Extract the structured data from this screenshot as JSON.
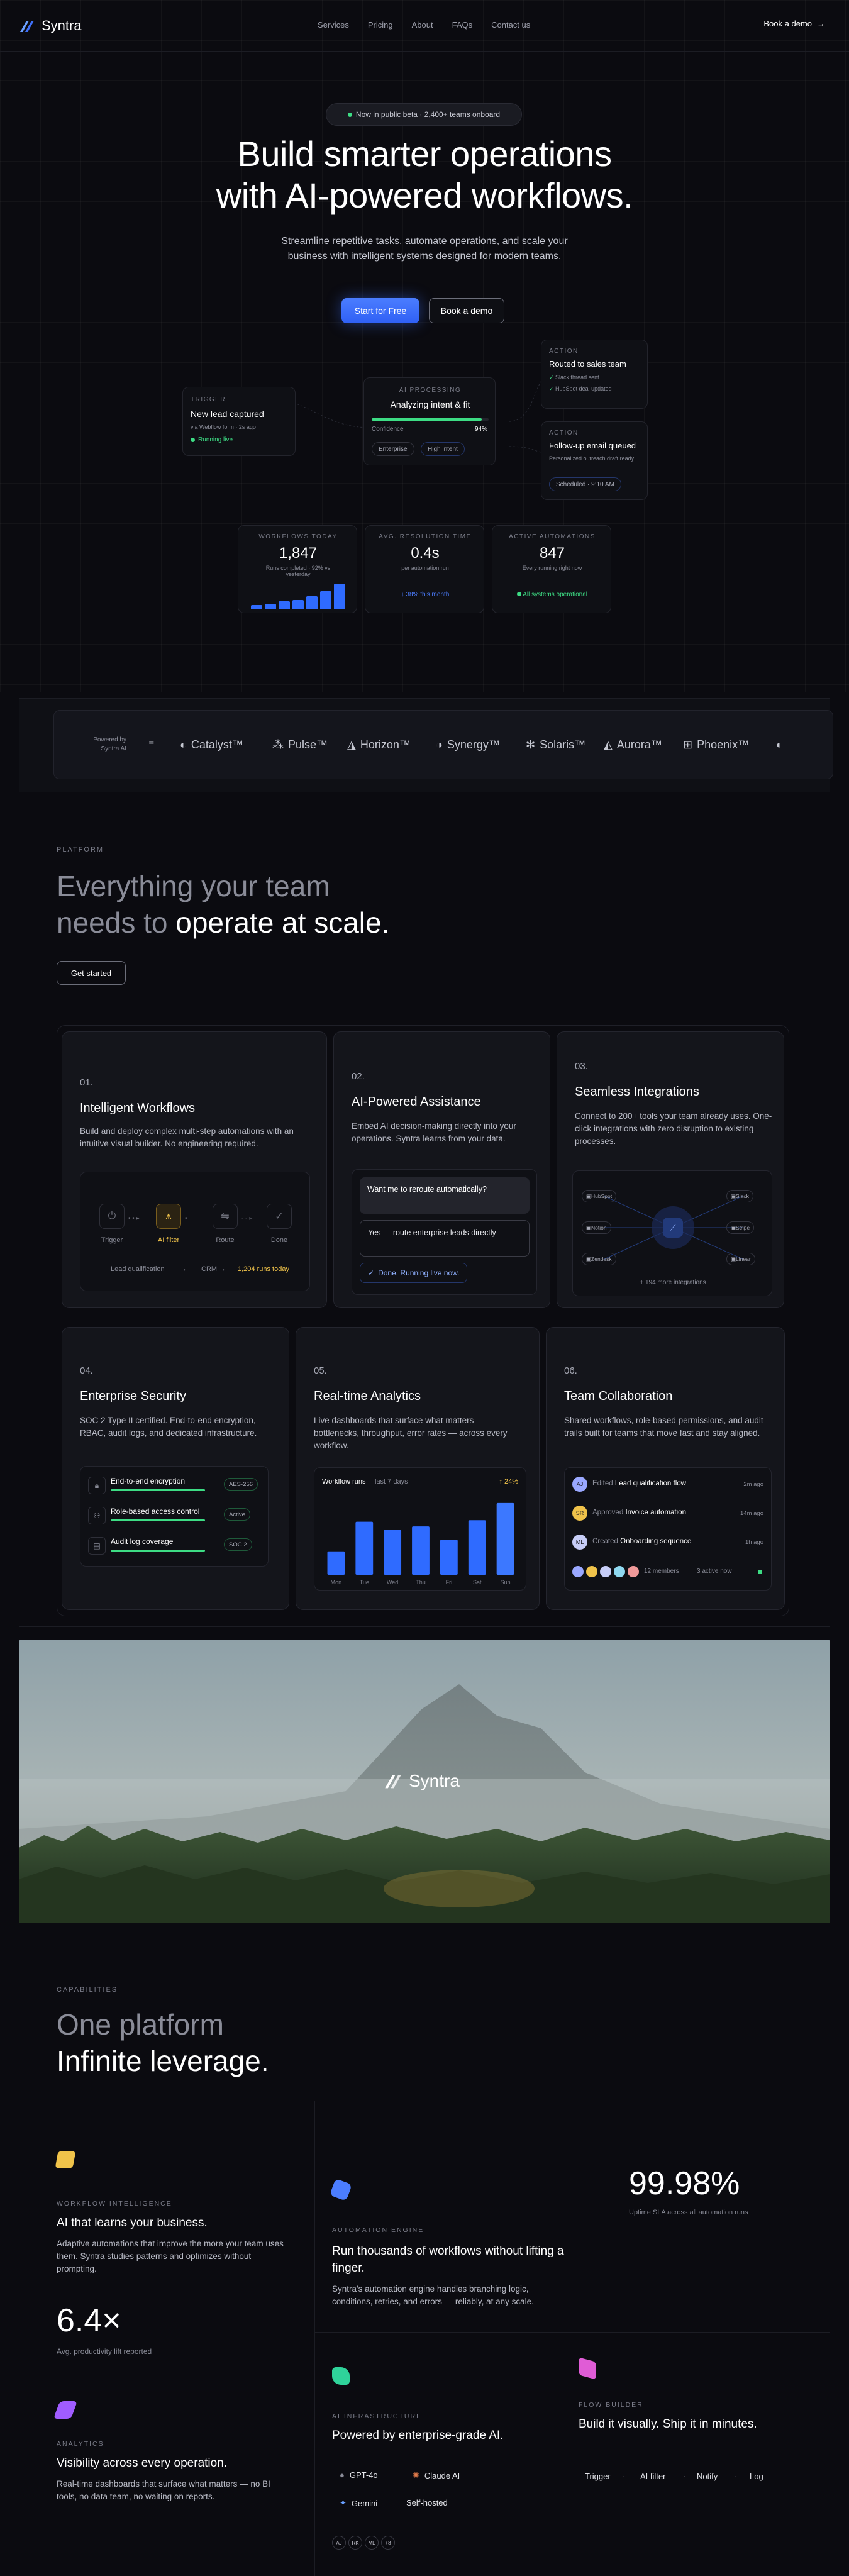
{
  "nav": {
    "brand": "Syntra",
    "links": [
      "Services",
      "Pricing",
      "About",
      "FAQs",
      "Contact us"
    ],
    "cta": "Book a demo"
  },
  "hero": {
    "badge_text": "Now in public beta · 2,400+ teams onboard",
    "title_line1": "Build smarter operations",
    "title_line2": "with AI-powered workflows.",
    "subtitle": "Streamline repetitive tasks, automate operations, and scale your business with intelligent systems designed for modern teams.",
    "cta_primary": "Start for Free",
    "cta_secondary": "Book a demo"
  },
  "flow": {
    "trigger": {
      "tag": "TRIGGER",
      "title": "New lead captured",
      "meta": "via Webflow form · 2s ago",
      "status": "Running live"
    },
    "ai": {
      "tag": "AI PROCESSING",
      "title": "Analyzing intent & fit",
      "label": "Confidence",
      "pct": "94%",
      "progress": 0.94,
      "chip1": "Enterprise",
      "chip2": "High intent"
    },
    "action1": {
      "tag": "ACTION",
      "title": "Routed to sales team",
      "check1": "Slack thread sent",
      "check2": "HubSpot deal updated"
    },
    "action2": {
      "tag": "ACTION",
      "title": "Follow-up email queued",
      "meta": "Personalized outreach draft ready",
      "chip": "Scheduled · 9:10 AM"
    }
  },
  "stats": [
    {
      "tag": "WORKFLOWS TODAY",
      "value": "1,847",
      "meta": "Runs completed · 92% vs yesterday",
      "bars": [
        0.15,
        0.2,
        0.3,
        0.35,
        0.5,
        0.7,
        1.0
      ]
    },
    {
      "tag": "AVG. RESOLUTION TIME",
      "value": "0.4s",
      "meta": "per automation run",
      "foot": "↓ 38% this month"
    },
    {
      "tag": "ACTIVE AUTOMATIONS",
      "value": "847",
      "meta": "Every running right now",
      "foot": "All systems operational"
    }
  ],
  "logos": {
    "powered": "Powered by Syntra AI",
    "items": [
      "Catalyst™",
      "Pulse™",
      "Horizon™",
      "Synergy™",
      "Solaris™",
      "Aurora™",
      "Phoenix™"
    ]
  },
  "platform": {
    "tag": "PLATFORM",
    "title_line1": "Everything your team",
    "title_line2a": "needs to",
    "title_line2b": " operate at scale.",
    "cta": "Get started"
  },
  "features": [
    {
      "num": "01.",
      "title": "Intelligent Workflows",
      "desc": "Build and deploy complex multi-step automations with an intuitive visual builder. No engineering required.",
      "steps": [
        "Trigger",
        "AI filter",
        "Route",
        "Done"
      ],
      "foot_a": "Lead qualification",
      "foot_b": "CRM",
      "foot_c": "1,204 runs today"
    },
    {
      "num": "02.",
      "title": "AI-Powered Assistance",
      "desc": "Embed AI decision-making directly into your operations. Syntra learns from your data.",
      "msg1": "Want me to reroute automatically?",
      "msg2": "Yes — route enterprise leads directly",
      "msg3": "Done. Running live now."
    },
    {
      "num": "03.",
      "title": "Seamless Integrations",
      "desc": "Connect to 200+ tools your team already uses. One-click integrations with zero disruption to existing processes.",
      "apps": [
        "HubSpot",
        "Slack",
        "Notion",
        "Stripe",
        "Zendesk",
        "Linear"
      ],
      "foot": "+ 194 more integrations"
    },
    {
      "num": "04.",
      "title": "Enterprise Security",
      "desc": "SOC 2 Type II certified. End-to-end encryption, RBAC, audit logs, and dedicated infrastructure.",
      "rows": [
        {
          "label": "End-to-end encryption",
          "badge": "AES-256"
        },
        {
          "label": "Role-based access control",
          "badge": "Active"
        },
        {
          "label": "Audit log coverage",
          "badge": "SOC 2"
        }
      ]
    },
    {
      "num": "05.",
      "title": "Real-time Analytics",
      "desc": "Live dashboards that surface what matters — bottlenecks, throughput, error rates — across every workflow.",
      "chart_title": "Workflow runs",
      "chart_range": "last 7 days",
      "chart_delta": "↑ 24%"
    },
    {
      "num": "06.",
      "title": "Team Collaboration",
      "desc": "Shared workflows, role-based permissions, and audit trails built for teams that move fast and stay aligned.",
      "activity": [
        {
          "initials": "AJ",
          "verb": "Edited",
          "obj": "Lead qualification flow",
          "time": "2m ago"
        },
        {
          "initials": "SR",
          "verb": "Approved",
          "obj": "Invoice automation",
          "time": "14m ago"
        },
        {
          "initials": "ML",
          "verb": "Created",
          "obj": "Onboarding sequence",
          "time": "1h ago"
        }
      ],
      "members": "12 members",
      "active": "3 active now"
    }
  ],
  "chart_data": {
    "type": "bar",
    "categories": [
      "Mon",
      "Tue",
      "Wed",
      "Thu",
      "Fri",
      "Sat",
      "Sun"
    ],
    "values": [
      30,
      68,
      58,
      62,
      45,
      70,
      92
    ],
    "ylim": [
      0,
      100
    ]
  },
  "photo": {
    "brand": "Syntra"
  },
  "capabilities": {
    "tag": "CAPABILITIES",
    "title_line1": "One platform",
    "title_line2": "Infinite leverage.",
    "items": [
      {
        "tag": "WORKFLOW INTELLIGENCE",
        "title": "AI that learns your business.",
        "desc": "Adaptive automations that improve the more your team uses them. Syntra studies patterns and optimizes without prompting.",
        "stat": "6.4×",
        "stat_label": "Avg. productivity lift reported"
      },
      {
        "tag": "AUTOMATION ENGINE",
        "title": "Run thousands of workflows without lifting a finger.",
        "desc": "Syntra's automation engine handles branching logic, conditions, retries, and errors — reliably, at any scale."
      },
      {
        "stat": "99.98%",
        "stat_label": "Uptime SLA across all automation runs"
      },
      {
        "tag": "ANALYTICS",
        "title": "Visibility across every operation.",
        "desc": "Real-time dashboards that surface what matters — no BI tools, no data team, no waiting on reports."
      },
      {
        "tag": "AI INFRASTRUCTURE",
        "title": "Powered by enterprise-grade AI.",
        "models": [
          "GPT-4o",
          "Claude AI",
          "Gemini",
          "Self-hosted"
        ],
        "avatars": [
          "AJ",
          "RK",
          "ML",
          "+8"
        ]
      },
      {
        "tag": "FLOW BUILDER",
        "title": "Build it visually. Ship it in minutes.",
        "steps": [
          "Trigger",
          "AI filter",
          "Notify",
          "Log"
        ]
      }
    ]
  }
}
